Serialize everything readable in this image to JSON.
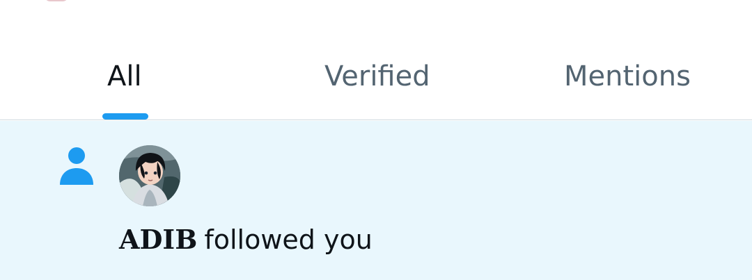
{
  "tabs": [
    {
      "label": "All",
      "active": true
    },
    {
      "label": "Verified",
      "active": false
    },
    {
      "label": "Mentions",
      "active": false
    }
  ],
  "notification": {
    "type_icon": "person-icon",
    "avatar": "avatar",
    "follower_name": "ADIB",
    "action_text": "followed you"
  },
  "colors": {
    "accent": "#1d9bf0",
    "active_tab_text": "#0f1419",
    "inactive_tab_text": "#536471",
    "notification_background": "#e9f7fd",
    "divider": "#cfd9de"
  }
}
